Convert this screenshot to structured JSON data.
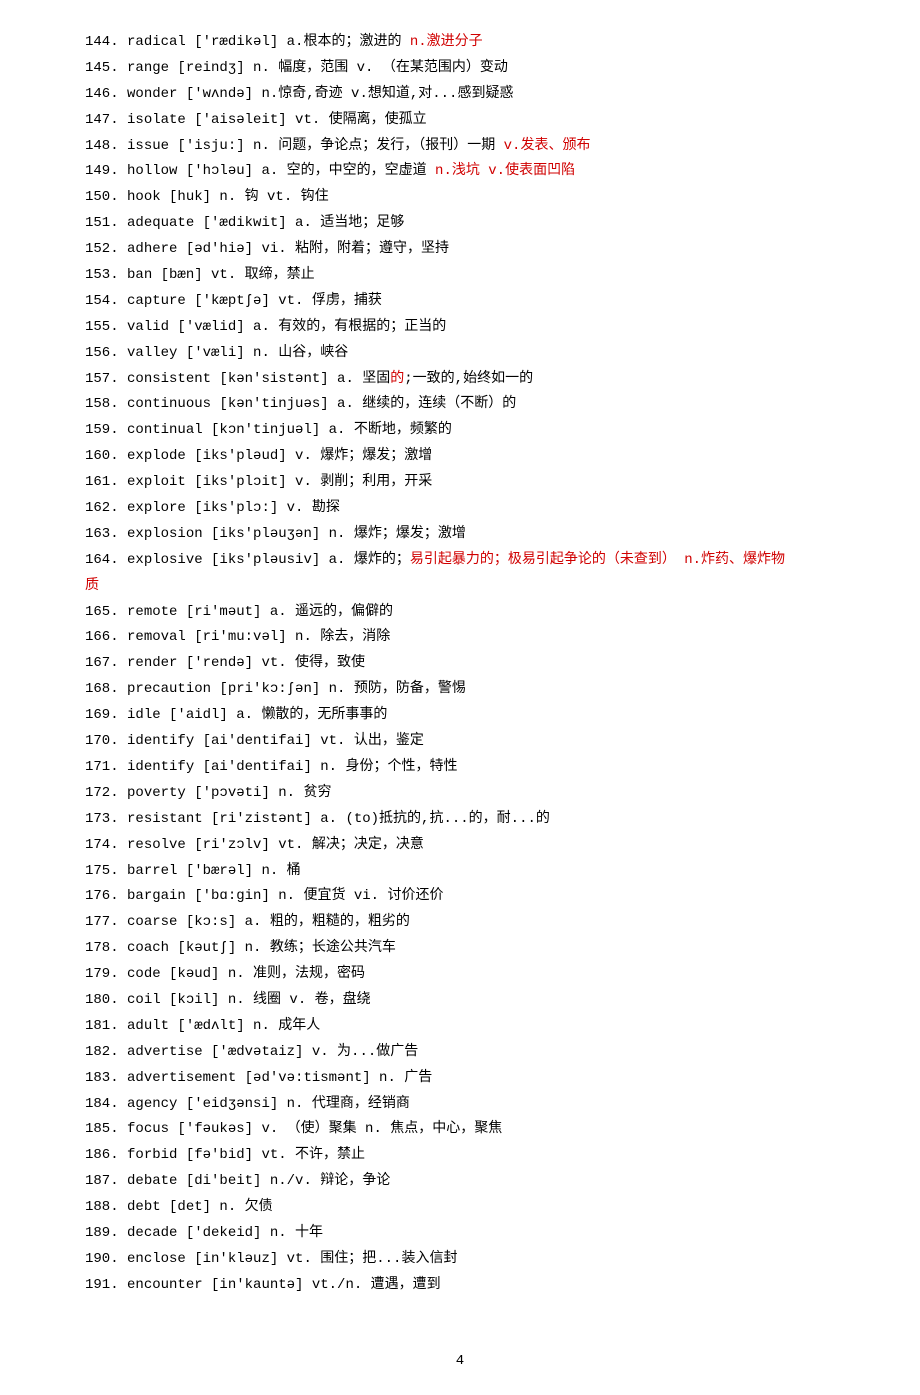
{
  "entries": [
    {
      "num": "144.",
      "segs": [
        {
          "t": "radical ['rædikəl] a.根本的；激进的"
        },
        {
          "t": "    n.激进分子",
          "red": true
        }
      ]
    },
    {
      "num": "145.",
      "segs": [
        {
          "t": "range [reindʒ] n. 幅度，范围 v. （在某范围内）变动"
        }
      ]
    },
    {
      "num": "146.",
      "segs": [
        {
          "t": "wonder ['wʌndə] n.惊奇,奇迹 v.想知道,对...感到疑惑"
        }
      ]
    },
    {
      "num": "147.",
      "segs": [
        {
          "t": "isolate ['aisəleit] vt. 使隔离，使孤立"
        }
      ]
    },
    {
      "num": "148.",
      "segs": [
        {
          "t": "issue ['isju:] n. 问题，争论点；发行，（报刊）一期"
        },
        {
          "t": "   v.发表、颁布",
          "red": true
        }
      ]
    },
    {
      "num": "149.",
      "segs": [
        {
          "t": "hollow ['hɔləu] a. 空的，中空的，空虚道"
        },
        {
          "t": "   n.浅坑   v.使表面凹陷",
          "red": true
        }
      ]
    },
    {
      "num": "150.",
      "segs": [
        {
          "t": "hook [huk] n. 钩 vt. 钩住"
        }
      ]
    },
    {
      "num": "151.",
      "segs": [
        {
          "t": "adequate ['ædikwit] a. 适当地；足够"
        }
      ]
    },
    {
      "num": "152.",
      "segs": [
        {
          "t": "adhere [əd'hiə] vi. 粘附，附着；遵守，坚持"
        }
      ]
    },
    {
      "num": "153.",
      "segs": [
        {
          "t": "ban [bæn] vt. 取缔，禁止"
        }
      ]
    },
    {
      "num": "154.",
      "segs": [
        {
          "t": "capture ['kæptʃə] vt. 俘虏，捕获"
        }
      ]
    },
    {
      "num": "155.",
      "segs": [
        {
          "t": "valid ['vælid] a. 有效的，有根据的；正当的"
        }
      ]
    },
    {
      "num": "156.",
      "segs": [
        {
          "t": "valley ['væli] n. 山谷，峡谷"
        }
      ]
    },
    {
      "num": "157.",
      "segs": [
        {
          "t": "consistent [kən'sistənt] a. 坚固"
        },
        {
          "t": "的",
          "red": true
        },
        {
          "t": ";一致的,始终如一的"
        }
      ]
    },
    {
      "num": "158.",
      "segs": [
        {
          "t": "continuous [kən'tinjuəs] a. 继续的，连续（不断）的"
        }
      ]
    },
    {
      "num": "159.",
      "segs": [
        {
          "t": "continual [kɔn'tinjuəl] a. 不断地，频繁的"
        }
      ]
    },
    {
      "num": "160.",
      "segs": [
        {
          "t": "explode [iks'pləud] v. 爆炸；爆发；激增"
        }
      ]
    },
    {
      "num": "161.",
      "segs": [
        {
          "t": "exploit [iks'plɔit] v. 剥削；利用，开采"
        }
      ]
    },
    {
      "num": "162.",
      "segs": [
        {
          "t": "explore [iks'plɔ:] v. 勘探"
        }
      ]
    },
    {
      "num": "163.",
      "segs": [
        {
          "t": "explosion [iks'pləuʒən] n. 爆炸；爆发；激增"
        }
      ]
    },
    {
      "num": "164.",
      "segs": [
        {
          "t": "explosive [iks'pləusiv] a. 爆炸的；"
        },
        {
          "t": "易引起暴力的；极易引起争论的（未查到）   n.炸药、爆炸物",
          "red": true
        }
      ]
    },
    {
      "num": "",
      "segs": [
        {
          "t": "质",
          "red": true
        }
      ],
      "noindent": true
    },
    {
      "num": "165.",
      "segs": [
        {
          "t": "remote [ri'məut] a. 遥远的，偏僻的"
        }
      ]
    },
    {
      "num": "166.",
      "segs": [
        {
          "t": "removal [ri'mu:vəl] n. 除去，消除"
        }
      ]
    },
    {
      "num": "167.",
      "segs": [
        {
          "t": "render ['rendə] vt. 使得，致使"
        }
      ]
    },
    {
      "num": "168.",
      "segs": [
        {
          "t": "precaution [pri'kɔ:ʃən] n. 预防，防备，警惕"
        }
      ]
    },
    {
      "num": "169.",
      "segs": [
        {
          "t": "idle ['aidl] a. 懒散的，无所事事的"
        }
      ]
    },
    {
      "num": "170.",
      "segs": [
        {
          "t": "identify [ai'dentifai] vt. 认出，鉴定"
        }
      ]
    },
    {
      "num": "171.",
      "segs": [
        {
          "t": "identify [ai'dentifai] n. 身份；个性，特性"
        }
      ]
    },
    {
      "num": "172.",
      "segs": [
        {
          "t": "poverty ['pɔvəti] n. 贫穷"
        }
      ]
    },
    {
      "num": "173.",
      "segs": [
        {
          "t": "resistant [ri'zistənt] a. (to)抵抗的,抗...的，耐...的"
        }
      ]
    },
    {
      "num": "174.",
      "segs": [
        {
          "t": "resolve [ri'zɔlv] vt. 解决；决定，决意"
        }
      ]
    },
    {
      "num": "175.",
      "segs": [
        {
          "t": "barrel ['bærəl] n. 桶"
        }
      ]
    },
    {
      "num": "176.",
      "segs": [
        {
          "t": "bargain ['bɑ:gin] n. 便宜货 vi. 讨价还价"
        }
      ]
    },
    {
      "num": "177.",
      "segs": [
        {
          "t": "coarse [kɔ:s] a. 粗的，粗糙的，粗劣的"
        }
      ]
    },
    {
      "num": "178.",
      "segs": [
        {
          "t": "coach [kəutʃ] n. 教练；长途公共汽车"
        }
      ]
    },
    {
      "num": "179.",
      "segs": [
        {
          "t": "code [kəud] n. 准则，法规，密码"
        }
      ]
    },
    {
      "num": "180.",
      "segs": [
        {
          "t": "coil [kɔil] n. 线圈 v. 卷，盘绕"
        }
      ]
    },
    {
      "num": "181.",
      "segs": [
        {
          "t": "adult ['ædʌlt] n. 成年人"
        }
      ]
    },
    {
      "num": "182.",
      "segs": [
        {
          "t": "advertise ['ædvətaiz] v. 为...做广告"
        }
      ]
    },
    {
      "num": "183.",
      "segs": [
        {
          "t": "advertisement [əd'və:tismənt] n. 广告"
        }
      ]
    },
    {
      "num": "184.",
      "segs": [
        {
          "t": "agency ['eidʒənsi] n. 代理商，经销商"
        }
      ]
    },
    {
      "num": "185.",
      "segs": [
        {
          "t": "focus ['fəukəs] v. （使）聚集 n. 焦点，中心，聚焦"
        }
      ]
    },
    {
      "num": "186.",
      "segs": [
        {
          "t": "forbid [fə'bid] vt. 不许，禁止"
        }
      ]
    },
    {
      "num": "187.",
      "segs": [
        {
          "t": "debate [di'beit] n./v. 辩论，争论"
        }
      ]
    },
    {
      "num": "188.",
      "segs": [
        {
          "t": "debt [det] n. 欠债"
        }
      ]
    },
    {
      "num": "189.",
      "segs": [
        {
          "t": "decade ['dekeid] n. 十年"
        }
      ]
    },
    {
      "num": "190.",
      "segs": [
        {
          "t": "enclose [in'kləuz] vt. 围住；把...装入信封"
        }
      ]
    },
    {
      "num": "191.",
      "segs": [
        {
          "t": "encounter [in'kauntə] vt./n. 遭遇，遭到"
        }
      ]
    }
  ],
  "pageNumber": "4"
}
